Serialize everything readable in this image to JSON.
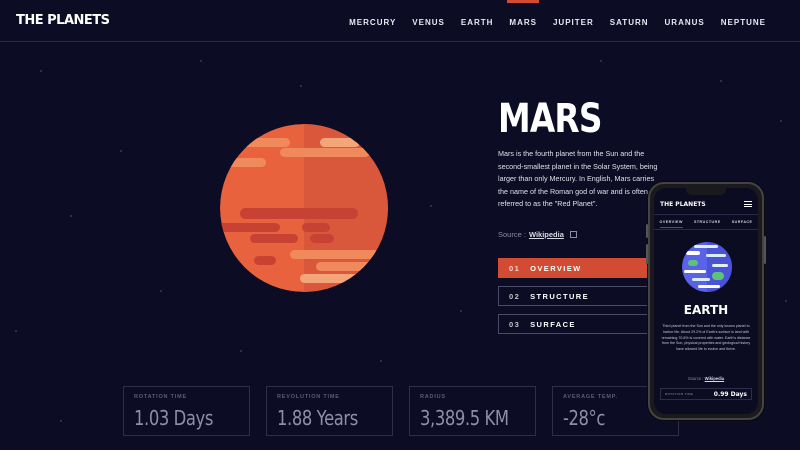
{
  "header": {
    "logo": "THE PLANETS",
    "nav": [
      "MERCURY",
      "VENUS",
      "EARTH",
      "MARS",
      "JUPITER",
      "SATURN",
      "URANUS",
      "NEPTUNE"
    ],
    "active_nav": "MARS"
  },
  "planet": {
    "name": "MARS",
    "description": "Mars is the fourth planet from the Sun and the second-smallest planet in the Solar System, being larger than only Mercury. In English, Mars carries the name of the Roman god of war and is often referred to as the \"Red Planet\".",
    "source_label": "Source :",
    "source_link": "Wikipedia",
    "icon": "external-link-icon"
  },
  "tabs": [
    {
      "num": "01",
      "label": "OVERVIEW",
      "active": true
    },
    {
      "num": "02",
      "label": "STRUCTURE",
      "active": false
    },
    {
      "num": "03",
      "label": "SURFACE",
      "active": false
    }
  ],
  "stats": [
    {
      "label": "ROTATION TIME",
      "value": "1.03 Days"
    },
    {
      "label": "REVOLUTION TIME",
      "value": "1.88 Years"
    },
    {
      "label": "RADIUS",
      "value": "3,389.5 KM"
    },
    {
      "label": "AVERAGE TEMP.",
      "value": "-28°c"
    }
  ],
  "phone": {
    "logo": "THE PLANETS",
    "tabs": [
      "OVERVIEW",
      "STRUCTURE",
      "SURFACE"
    ],
    "planet_name": "EARTH",
    "description": "Third planet from the Sun and the only known planet to harbor life. About 29.2% of Earth's surface is land with remaining 70.8% is covered with water. Earth's distance from the Sun, physical properties and geological history have allowed life to evolve and thrive.",
    "source_label": "Source :",
    "source_link": "Wikipedia",
    "stat_label": "ROTATION TIME",
    "stat_value": "0.99 Days"
  },
  "colors": {
    "background": "#0c0c24",
    "accent": "#d14c32",
    "phone_tab_accent": "#6d2ed5",
    "mars_main": "#e8623d",
    "earth_main": "#5a63e8"
  }
}
